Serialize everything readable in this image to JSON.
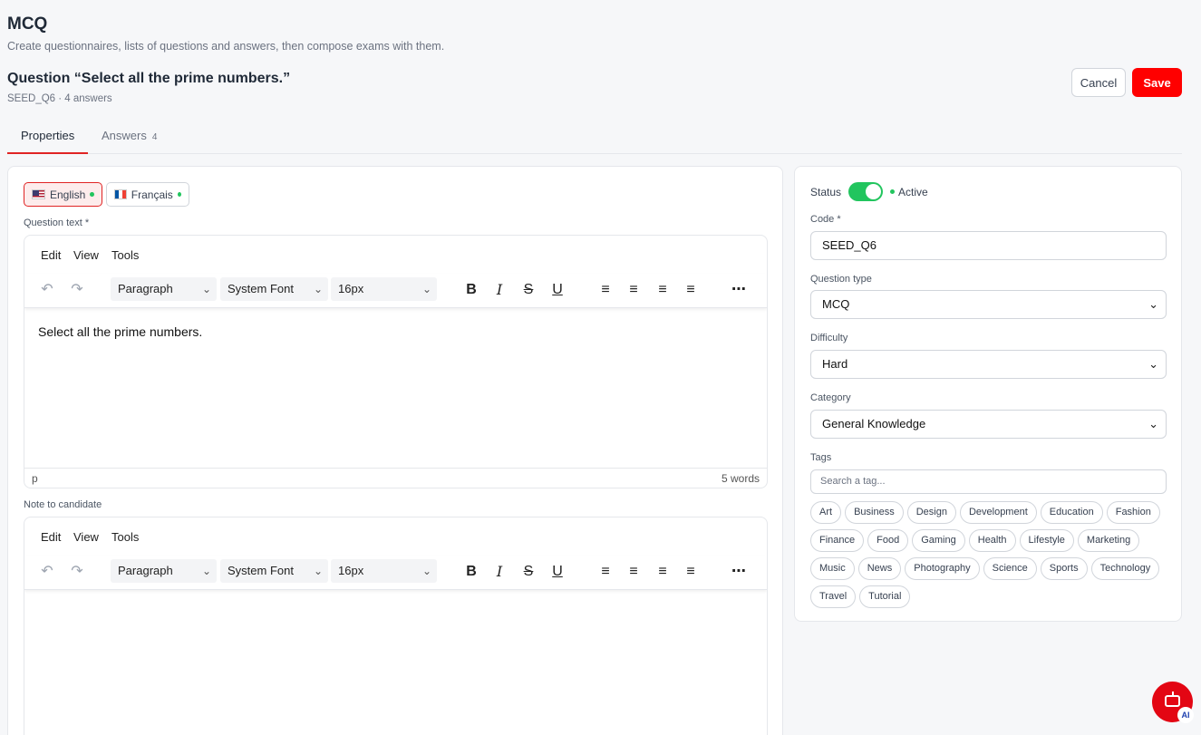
{
  "header": {
    "app_title": "MCQ",
    "subtitle": "Create questionnaires, lists of questions and answers, then compose exams with them.",
    "question_title": "Question “Select all the prime numbers.”",
    "question_meta": "SEED_Q6 · 4 answers",
    "cancel_label": "Cancel",
    "save_label": "Save"
  },
  "tabs": [
    {
      "label": "Properties",
      "active": true
    },
    {
      "label": "Answers",
      "count": "4",
      "active": false
    }
  ],
  "languages": [
    {
      "label": "English",
      "active": true
    },
    {
      "label": "Français",
      "active": false
    }
  ],
  "question_editor": {
    "label": "Question text *",
    "menu": [
      "Edit",
      "View",
      "Tools"
    ],
    "block_format": "Paragraph",
    "font_family": "System Font",
    "font_size": "16px",
    "content": "Select all the prime numbers.",
    "status_path": "p",
    "word_count": "5 words"
  },
  "note_editor": {
    "label": "Note to candidate",
    "menu": [
      "Edit",
      "View",
      "Tools"
    ],
    "block_format": "Paragraph",
    "font_family": "System Font",
    "font_size": "16px"
  },
  "properties": {
    "status_label": "Status",
    "status_value": "Active",
    "code_label": "Code *",
    "code_value": "SEED_Q6",
    "question_type_label": "Question type",
    "question_type_value": "MCQ",
    "difficulty_label": "Difficulty",
    "difficulty_value": "Hard",
    "category_label": "Category",
    "category_value": "General Knowledge",
    "tags_label": "Tags",
    "tags_placeholder": "Search a tag...",
    "tags": [
      "Art",
      "Business",
      "Design",
      "Development",
      "Education",
      "Fashion",
      "Finance",
      "Food",
      "Gaming",
      "Health",
      "Lifestyle",
      "Marketing",
      "Music",
      "News",
      "Photography",
      "Science",
      "Sports",
      "Technology",
      "Travel",
      "Tutorial"
    ]
  },
  "colors": {
    "accent": "#ff0000",
    "active_green": "#22c55e"
  }
}
